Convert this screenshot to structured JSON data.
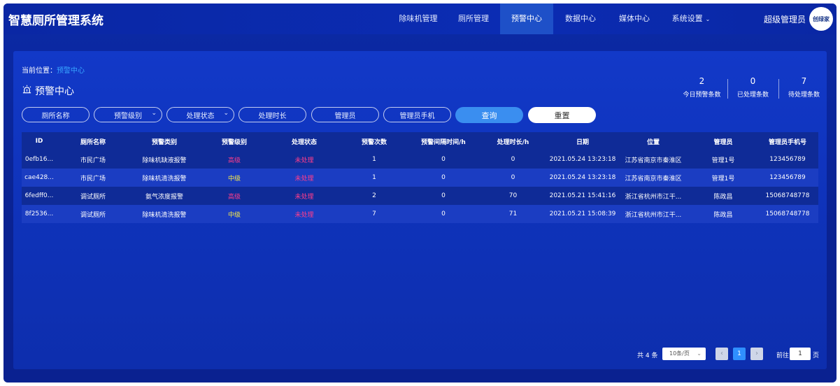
{
  "app": {
    "title": "智慧厕所管理系统"
  },
  "nav": {
    "items": [
      {
        "label": "除味机管理"
      },
      {
        "label": "厕所管理"
      },
      {
        "label": "预警中心"
      },
      {
        "label": "数据中心"
      },
      {
        "label": "媒体中心"
      },
      {
        "label": "系统设置"
      }
    ],
    "active": "预警中心"
  },
  "user": {
    "name": "超级管理员",
    "avatar_text": "创绿家"
  },
  "breadcrumb": {
    "prefix": "当前位置：",
    "current": "预警中心"
  },
  "page": {
    "title": "预警中心",
    "icon": "alarm-icon"
  },
  "stats": [
    {
      "value": "2",
      "label": "今日预警条数"
    },
    {
      "value": "0",
      "label": "已处理条数"
    },
    {
      "value": "7",
      "label": "待处理条数"
    }
  ],
  "filters": {
    "toilet_name": "厕所名称",
    "alert_level": "预警级别",
    "process_status": "处理状态",
    "process_duration": "处理时长",
    "admin": "管理员",
    "admin_phone": "管理员手机",
    "query_label": "查询",
    "reset_label": "重置"
  },
  "table": {
    "headers": [
      "ID",
      "厕所名称",
      "预警类别",
      "预警级别",
      "处理状态",
      "预警次数",
      "预警间隔时间/h",
      "处理时长/h",
      "日期",
      "位置",
      "管理员",
      "管理员手机号"
    ],
    "rows": [
      [
        "0efb16...",
        "市民广场",
        "除味机缺液报警",
        "高级",
        "未处理",
        "1",
        "0",
        "0",
        "2021.05.24 13:23:18",
        "江苏省南京市秦淮区",
        "管理1号",
        "123456789"
      ],
      [
        "cae428...",
        "市民广场",
        "除味机清洗报警",
        "中级",
        "未处理",
        "1",
        "0",
        "0",
        "2021.05.24 13:23:18",
        "江苏省南京市秦淮区",
        "管理1号",
        "123456789"
      ],
      [
        "6fedff0...",
        "调试厕所",
        "氨气浓度报警",
        "高级",
        "未处理",
        "2",
        "0",
        "70",
        "2021.05.21 15:41:16",
        "浙江省杭州市江干...",
        "陈政昌",
        "15068748778"
      ],
      [
        "8f2536...",
        "调试厕所",
        "除味机清洗报警",
        "中级",
        "未处理",
        "7",
        "0",
        "71",
        "2021.05.21 15:08:39",
        "浙江省杭州市江干...",
        "陈政昌",
        "15068748778"
      ]
    ]
  },
  "pagination": {
    "total_text": "共 4 条",
    "page_size": "10条/页",
    "current_page": "1",
    "goto_label": "前往",
    "goto_value": "1",
    "page_unit": "页"
  },
  "colors": {
    "level_high": "#ff3d8b",
    "level_mid": "#f5e84a",
    "status_pending": "#ff3d8b",
    "accent": "#3a8ef0"
  }
}
